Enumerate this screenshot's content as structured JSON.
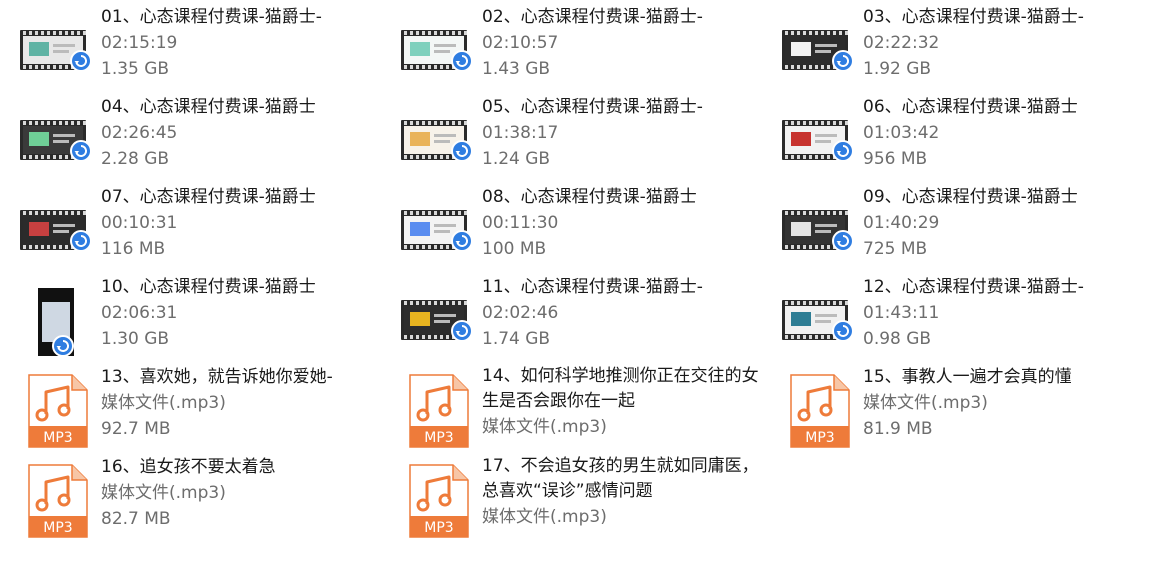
{
  "files": [
    {
      "name": "01、心态课程付费课-猫爵士-",
      "line2": "02:15:19",
      "line3": "1.35 GB",
      "kind": "video"
    },
    {
      "name": "02、心态课程付费课-猫爵士-",
      "line2": "02:10:57",
      "line3": "1.43 GB",
      "kind": "video"
    },
    {
      "name": "03、心态课程付费课-猫爵士-",
      "line2": "02:22:32",
      "line3": "1.92 GB",
      "kind": "video"
    },
    {
      "name": "04、心态课程付费课-猫爵士",
      "line2": "02:26:45",
      "line3": "2.28 GB",
      "kind": "video"
    },
    {
      "name": "05、心态课程付费课-猫爵士-",
      "line2": "01:38:17",
      "line3": "1.24 GB",
      "kind": "video"
    },
    {
      "name": "06、心态课程付费课-猫爵士",
      "line2": "01:03:42",
      "line3": "956 MB",
      "kind": "video"
    },
    {
      "name": "07、心态课程付费课-猫爵士",
      "line2": "00:10:31",
      "line3": "116 MB",
      "kind": "video-dark"
    },
    {
      "name": "08、心态课程付费课-猫爵士",
      "line2": "00:11:30",
      "line3": "100 MB",
      "kind": "video"
    },
    {
      "name": "09、心态课程付费课-猫爵士",
      "line2": "01:40:29",
      "line3": "725 MB",
      "kind": "video-dark"
    },
    {
      "name": "10、心态课程付费课-猫爵士",
      "line2": "02:06:31",
      "line3": "1.30 GB",
      "kind": "video-portrait"
    },
    {
      "name": "11、心态课程付费课-猫爵士-",
      "line2": "02:02:46",
      "line3": "1.74 GB",
      "kind": "video"
    },
    {
      "name": "12、心态课程付费课-猫爵士-",
      "line2": "01:43:11",
      "line3": "0.98 GB",
      "kind": "video"
    },
    {
      "name": "13、喜欢她，就告诉她你爱她-",
      "line2": "媒体文件(.mp3)",
      "line3": "92.7 MB",
      "kind": "mp3"
    },
    {
      "name": "14、如何科学地推测你正在交往的女生是否会跟你在一起",
      "line2": "媒体文件(.mp3)",
      "line3": "",
      "kind": "mp3",
      "wrap": true
    },
    {
      "name": "15、事教人一遍才会真的懂",
      "line2": "媒体文件(.mp3)",
      "line3": "81.9 MB",
      "kind": "mp3"
    },
    {
      "name": "16、追女孩不要太着急",
      "line2": "媒体文件(.mp3)",
      "line3": "82.7 MB",
      "kind": "mp3"
    },
    {
      "name": "17、不会追女孩的男生就如同庸医，总喜欢“误诊”感情问题",
      "line2": "媒体文件(.mp3)",
      "line3": "",
      "kind": "mp3",
      "wrap": true
    }
  ],
  "mp3_label": "MP3",
  "colors": {
    "badge": "#2f7de1",
    "mp3_orange": "#f0803c",
    "mp3_band": "#ee7b3a",
    "name": "#1a1a1a",
    "meta": "#6d6d6d"
  },
  "icons": {
    "video": "video-file-icon",
    "player_badge": "player-badge-icon",
    "audio": "mp3-file-icon"
  }
}
